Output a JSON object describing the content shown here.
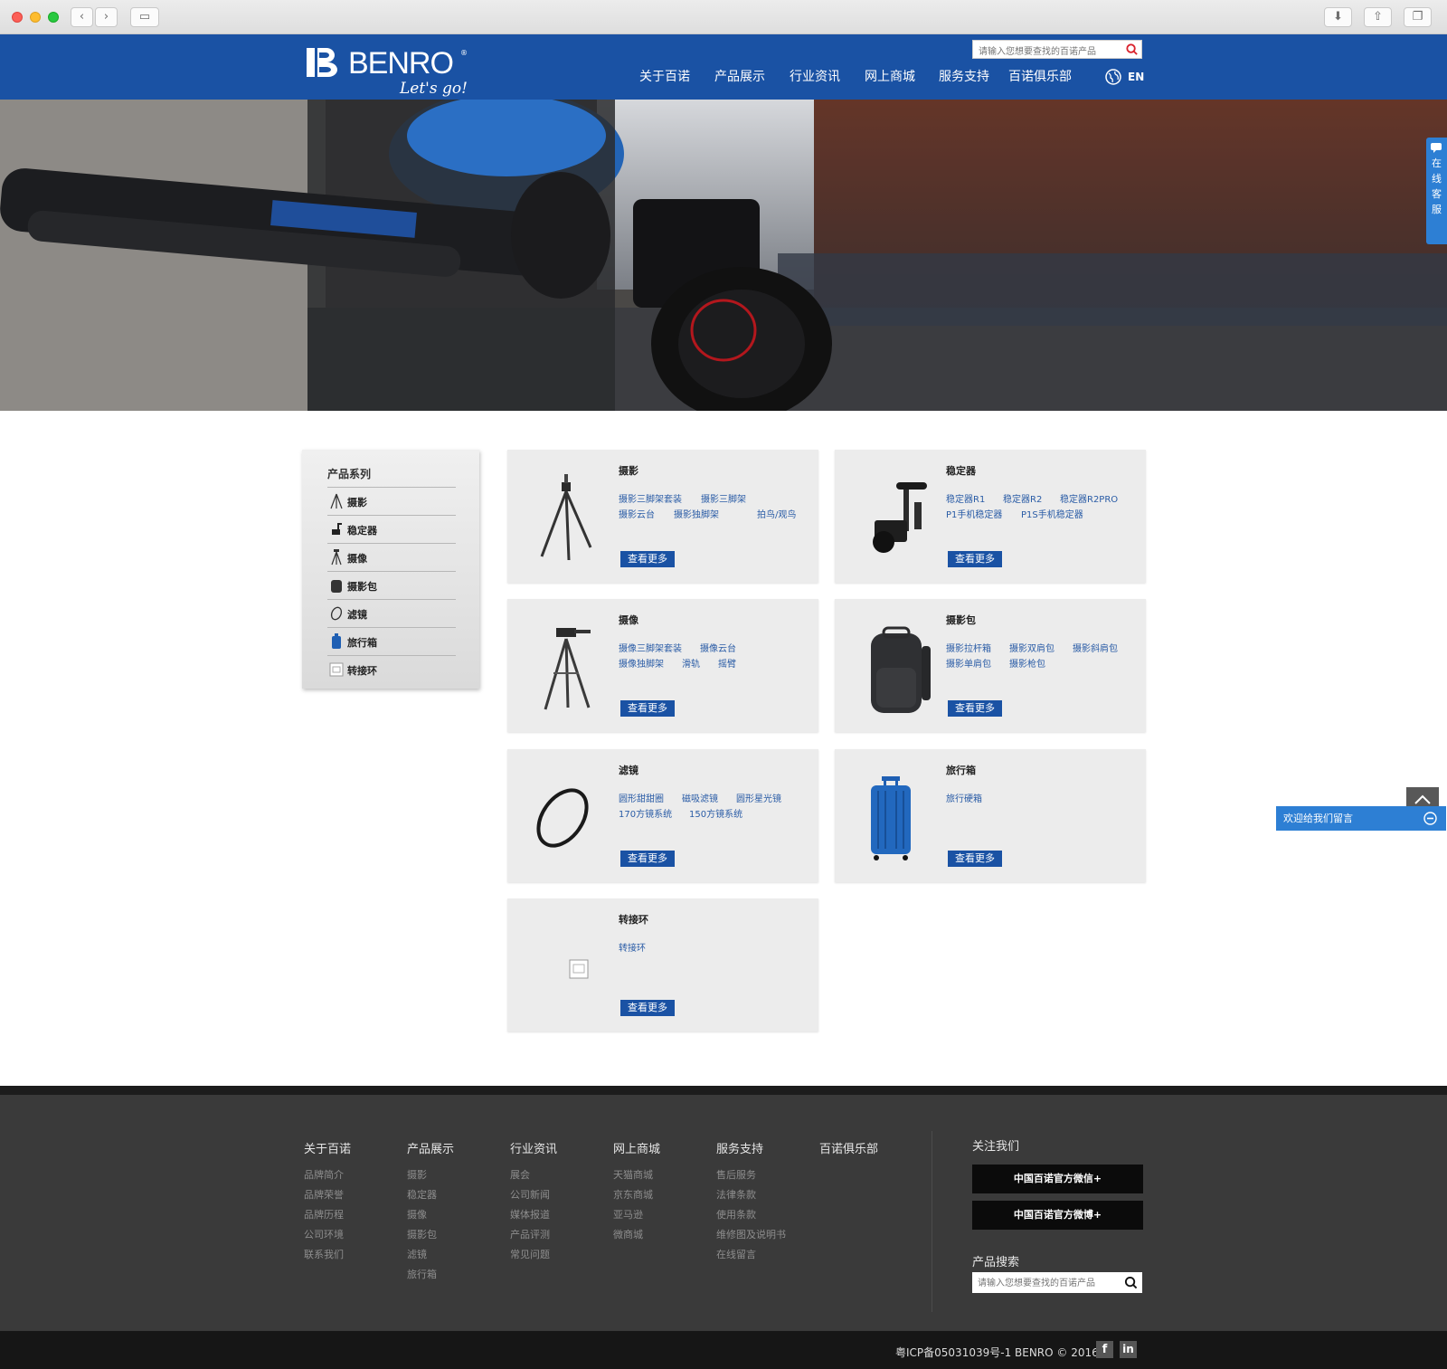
{
  "header": {
    "brand": "BENRO",
    "registered": "®",
    "tagline": "Let's go!",
    "search_placeholder": "请输入您想要查找的百诺产品",
    "nav": [
      "关于百诺",
      "产品展示",
      "行业资讯",
      "网上商城",
      "服务支持",
      "百诺俱乐部"
    ],
    "lang": "EN"
  },
  "chat_tab": "在线客服",
  "sidebar": {
    "title": "产品系列",
    "items": [
      {
        "label": "摄影",
        "icon": "tripod-icon"
      },
      {
        "label": "稳定器",
        "icon": "gimbal-icon"
      },
      {
        "label": "摄像",
        "icon": "video-tripod-icon"
      },
      {
        "label": "摄影包",
        "icon": "bag-icon"
      },
      {
        "label": "滤镜",
        "icon": "filter-icon"
      },
      {
        "label": "旅行箱",
        "icon": "suitcase-icon"
      },
      {
        "label": "转接环",
        "icon": "adapter-icon"
      }
    ]
  },
  "cards": [
    {
      "title": "摄影",
      "rows": [
        [
          "摄影三脚架套装",
          "摄影三脚架"
        ],
        [
          "摄影云台",
          "摄影独脚架",
          "拍鸟/观鸟"
        ]
      ],
      "more": "查看更多"
    },
    {
      "title": "稳定器",
      "rows": [
        [
          "稳定器R1",
          "稳定器R2",
          "稳定器R2PRO"
        ],
        [
          "P1手机稳定器",
          "P1S手机稳定器"
        ]
      ],
      "more": "查看更多"
    },
    {
      "title": "摄像",
      "rows": [
        [
          "摄像三脚架套装",
          "摄像云台"
        ],
        [
          "摄像独脚架",
          "滑轨",
          "摇臂"
        ]
      ],
      "more": "查看更多"
    },
    {
      "title": "摄影包",
      "rows": [
        [
          "摄影拉杆箱",
          "摄影双肩包",
          "摄影斜肩包"
        ],
        [
          "摄影单肩包",
          "摄影枪包"
        ]
      ],
      "more": "查看更多"
    },
    {
      "title": "滤镜",
      "rows": [
        [
          "圆形甜甜圈",
          "磁吸滤镜",
          "圆形星光镜"
        ],
        [
          "170方镜系统",
          "150方镜系统"
        ]
      ],
      "more": "查看更多"
    },
    {
      "title": "旅行箱",
      "rows": [
        [
          "旅行硬箱"
        ]
      ],
      "more": "查看更多"
    },
    {
      "title": "转接环",
      "rows": [
        [
          "转接环"
        ]
      ],
      "more": "查看更多"
    }
  ],
  "message_bar": "欢迎给我们留言",
  "footer": {
    "columns": [
      {
        "head": "关于百诺",
        "items": [
          "品牌简介",
          "品牌荣誉",
          "品牌历程",
          "公司环境",
          "联系我们"
        ]
      },
      {
        "head": "产品展示",
        "items": [
          "摄影",
          "稳定器",
          "摄像",
          "摄影包",
          "滤镜",
          "旅行箱"
        ]
      },
      {
        "head": "行业资讯",
        "items": [
          "展会",
          "公司新闻",
          "媒体报道",
          "产品评测",
          "常见问题"
        ]
      },
      {
        "head": "网上商城",
        "items": [
          "天猫商城",
          "京东商城",
          "亚马逊",
          "微商城"
        ]
      },
      {
        "head": "服务支持",
        "items": [
          "售后服务",
          "法律条款",
          "使用条款",
          "维修图及说明书",
          "在线留言"
        ]
      },
      {
        "head": "百诺俱乐部",
        "items": []
      }
    ],
    "follow_title": "关注我们",
    "wechat": "中国百诺官方微信+",
    "weibo": "中国百诺官方微博+",
    "search_title": "产品搜索",
    "search_placeholder": "请输入您想要查找的百诺产品",
    "copyright": "粤ICP备05031039号-1 BENRO © 2016",
    "social": [
      "f",
      "in"
    ]
  },
  "colors": {
    "brand_blue": "#1a52a4",
    "link_blue": "#2a5ca6",
    "chat_blue": "#2d7fd4",
    "footer_bg": "#3a3a3a"
  }
}
